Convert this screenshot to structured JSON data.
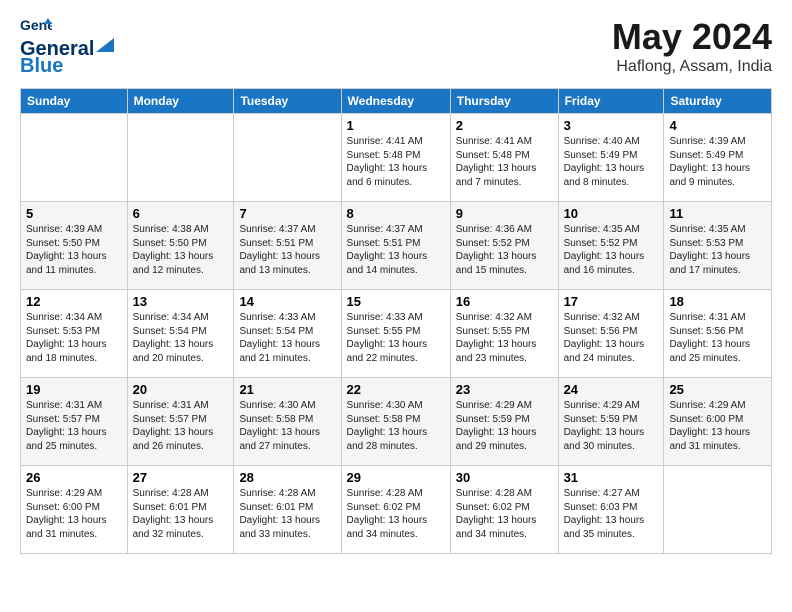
{
  "header": {
    "logo_line1": "General",
    "logo_line2": "Blue",
    "main_title": "May 2024",
    "subtitle": "Haflong, Assam, India"
  },
  "weekdays": [
    "Sunday",
    "Monday",
    "Tuesday",
    "Wednesday",
    "Thursday",
    "Friday",
    "Saturday"
  ],
  "weeks": [
    [
      {
        "day": "",
        "detail": ""
      },
      {
        "day": "",
        "detail": ""
      },
      {
        "day": "",
        "detail": ""
      },
      {
        "day": "1",
        "detail": "Sunrise: 4:41 AM\nSunset: 5:48 PM\nDaylight: 13 hours\nand 6 minutes."
      },
      {
        "day": "2",
        "detail": "Sunrise: 4:41 AM\nSunset: 5:48 PM\nDaylight: 13 hours\nand 7 minutes."
      },
      {
        "day": "3",
        "detail": "Sunrise: 4:40 AM\nSunset: 5:49 PM\nDaylight: 13 hours\nand 8 minutes."
      },
      {
        "day": "4",
        "detail": "Sunrise: 4:39 AM\nSunset: 5:49 PM\nDaylight: 13 hours\nand 9 minutes."
      }
    ],
    [
      {
        "day": "5",
        "detail": "Sunrise: 4:39 AM\nSunset: 5:50 PM\nDaylight: 13 hours\nand 11 minutes."
      },
      {
        "day": "6",
        "detail": "Sunrise: 4:38 AM\nSunset: 5:50 PM\nDaylight: 13 hours\nand 12 minutes."
      },
      {
        "day": "7",
        "detail": "Sunrise: 4:37 AM\nSunset: 5:51 PM\nDaylight: 13 hours\nand 13 minutes."
      },
      {
        "day": "8",
        "detail": "Sunrise: 4:37 AM\nSunset: 5:51 PM\nDaylight: 13 hours\nand 14 minutes."
      },
      {
        "day": "9",
        "detail": "Sunrise: 4:36 AM\nSunset: 5:52 PM\nDaylight: 13 hours\nand 15 minutes."
      },
      {
        "day": "10",
        "detail": "Sunrise: 4:35 AM\nSunset: 5:52 PM\nDaylight: 13 hours\nand 16 minutes."
      },
      {
        "day": "11",
        "detail": "Sunrise: 4:35 AM\nSunset: 5:53 PM\nDaylight: 13 hours\nand 17 minutes."
      }
    ],
    [
      {
        "day": "12",
        "detail": "Sunrise: 4:34 AM\nSunset: 5:53 PM\nDaylight: 13 hours\nand 18 minutes."
      },
      {
        "day": "13",
        "detail": "Sunrise: 4:34 AM\nSunset: 5:54 PM\nDaylight: 13 hours\nand 20 minutes."
      },
      {
        "day": "14",
        "detail": "Sunrise: 4:33 AM\nSunset: 5:54 PM\nDaylight: 13 hours\nand 21 minutes."
      },
      {
        "day": "15",
        "detail": "Sunrise: 4:33 AM\nSunset: 5:55 PM\nDaylight: 13 hours\nand 22 minutes."
      },
      {
        "day": "16",
        "detail": "Sunrise: 4:32 AM\nSunset: 5:55 PM\nDaylight: 13 hours\nand 23 minutes."
      },
      {
        "day": "17",
        "detail": "Sunrise: 4:32 AM\nSunset: 5:56 PM\nDaylight: 13 hours\nand 24 minutes."
      },
      {
        "day": "18",
        "detail": "Sunrise: 4:31 AM\nSunset: 5:56 PM\nDaylight: 13 hours\nand 25 minutes."
      }
    ],
    [
      {
        "day": "19",
        "detail": "Sunrise: 4:31 AM\nSunset: 5:57 PM\nDaylight: 13 hours\nand 25 minutes."
      },
      {
        "day": "20",
        "detail": "Sunrise: 4:31 AM\nSunset: 5:57 PM\nDaylight: 13 hours\nand 26 minutes."
      },
      {
        "day": "21",
        "detail": "Sunrise: 4:30 AM\nSunset: 5:58 PM\nDaylight: 13 hours\nand 27 minutes."
      },
      {
        "day": "22",
        "detail": "Sunrise: 4:30 AM\nSunset: 5:58 PM\nDaylight: 13 hours\nand 28 minutes."
      },
      {
        "day": "23",
        "detail": "Sunrise: 4:29 AM\nSunset: 5:59 PM\nDaylight: 13 hours\nand 29 minutes."
      },
      {
        "day": "24",
        "detail": "Sunrise: 4:29 AM\nSunset: 5:59 PM\nDaylight: 13 hours\nand 30 minutes."
      },
      {
        "day": "25",
        "detail": "Sunrise: 4:29 AM\nSunset: 6:00 PM\nDaylight: 13 hours\nand 31 minutes."
      }
    ],
    [
      {
        "day": "26",
        "detail": "Sunrise: 4:29 AM\nSunset: 6:00 PM\nDaylight: 13 hours\nand 31 minutes."
      },
      {
        "day": "27",
        "detail": "Sunrise: 4:28 AM\nSunset: 6:01 PM\nDaylight: 13 hours\nand 32 minutes."
      },
      {
        "day": "28",
        "detail": "Sunrise: 4:28 AM\nSunset: 6:01 PM\nDaylight: 13 hours\nand 33 minutes."
      },
      {
        "day": "29",
        "detail": "Sunrise: 4:28 AM\nSunset: 6:02 PM\nDaylight: 13 hours\nand 34 minutes."
      },
      {
        "day": "30",
        "detail": "Sunrise: 4:28 AM\nSunset: 6:02 PM\nDaylight: 13 hours\nand 34 minutes."
      },
      {
        "day": "31",
        "detail": "Sunrise: 4:27 AM\nSunset: 6:03 PM\nDaylight: 13 hours\nand 35 minutes."
      },
      {
        "day": "",
        "detail": ""
      }
    ]
  ]
}
